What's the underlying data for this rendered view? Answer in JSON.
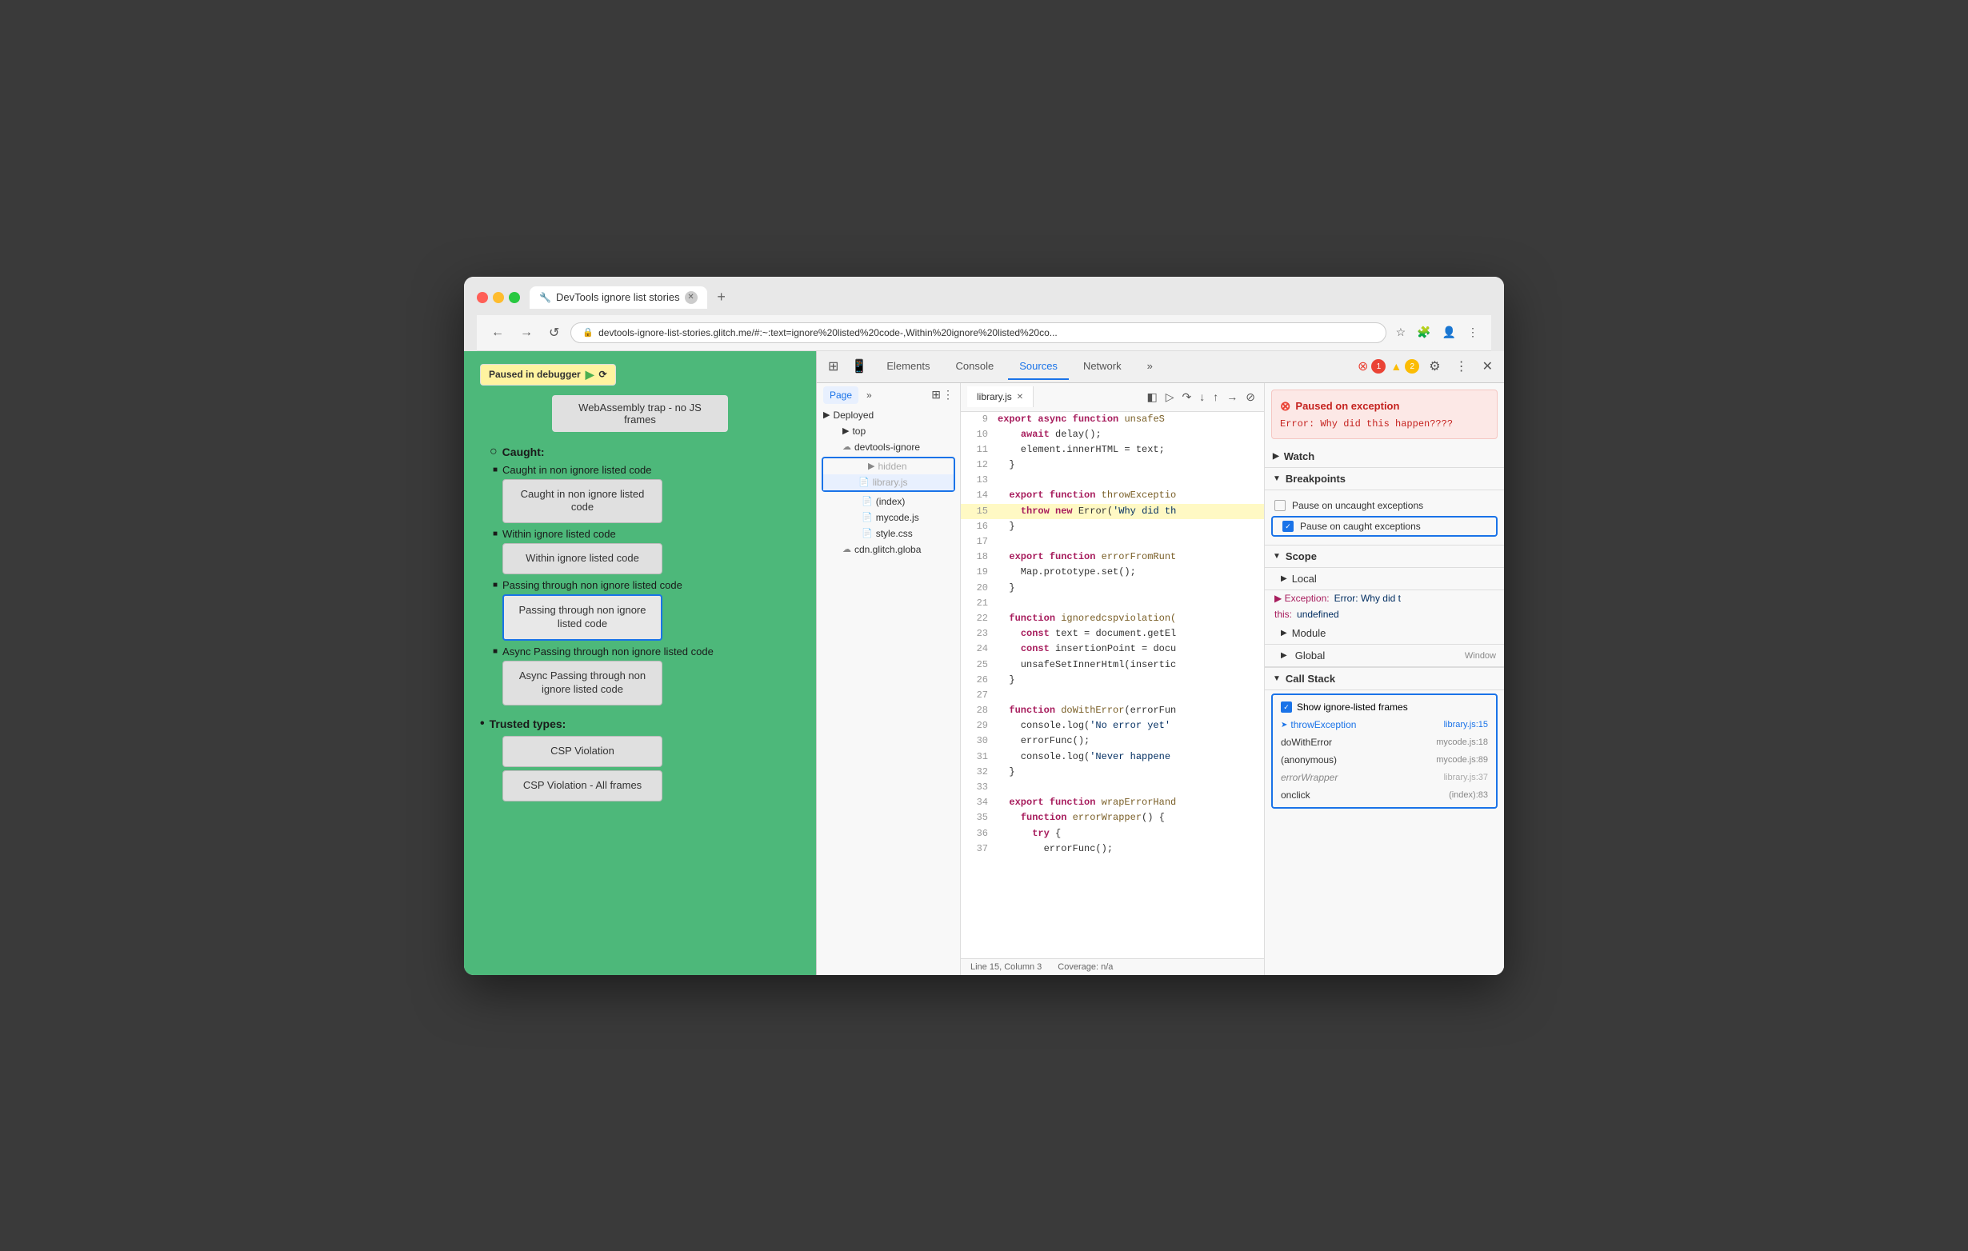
{
  "browser": {
    "tab_title": "DevTools ignore list stories",
    "tab_favicon": "🔧",
    "url": "devtools-ignore-list-stories.glitch.me/#:~:text=ignore%20listed%20code-,Within%20ignore%20listed%20co...",
    "new_tab_label": "+",
    "nav": {
      "back": "←",
      "forward": "→",
      "refresh": "↺",
      "bookmark": "☆",
      "extensions": "🧩",
      "profile": "👤",
      "menu": "⋮"
    }
  },
  "webpage": {
    "paused_label": "Paused in debugger",
    "webassembly_text": "WebAssembly trap - no JS frames",
    "sections": [
      {
        "label": "Caught:",
        "type": "circle",
        "children": [
          {
            "sublabel": "Caught in non ignore listed code",
            "button": "Caught in non ignore listed code"
          },
          {
            "sublabel": "Within ignore listed code",
            "button": "Within ignore listed code"
          },
          {
            "sublabel": "Passing through non ignore listed code",
            "button": "Passing through non ignore listed code",
            "highlighted": true
          },
          {
            "sublabel": "Async Passing through non ignore listed code",
            "button": "Async Passing through non ignore listed code"
          }
        ]
      },
      {
        "label": "Trusted types:",
        "type": "bullet",
        "children": [
          {
            "button": "CSP Violation"
          },
          {
            "button": "CSP Violation - All frames"
          }
        ]
      }
    ]
  },
  "devtools": {
    "tabs": [
      {
        "label": "Elements",
        "active": false
      },
      {
        "label": "Console",
        "active": false
      },
      {
        "label": "Sources",
        "active": true
      },
      {
        "label": "Network",
        "active": false
      },
      {
        "label": "»",
        "active": false
      }
    ],
    "error_count": "1",
    "warn_count": "2",
    "sources_subtabs": [
      {
        "label": "Page",
        "active": true
      },
      {
        "label": "»",
        "active": false
      }
    ],
    "file_tree": {
      "items": [
        {
          "label": "Deployed",
          "depth": 0,
          "icon": "▶",
          "type": "folder"
        },
        {
          "label": "top",
          "depth": 1,
          "icon": "▶",
          "type": "folder"
        },
        {
          "label": "devtools-ignore",
          "depth": 1,
          "icon": "▼",
          "type": "cloud",
          "expanded": true
        },
        {
          "label": "hidden",
          "depth": 2,
          "icon": "▶",
          "type": "folder",
          "in_box": true,
          "dim": true
        },
        {
          "label": "library.js",
          "depth": 3,
          "icon": "📄",
          "type": "file",
          "in_box": true,
          "dim": true,
          "selected": true
        },
        {
          "label": "(index)",
          "depth": 2,
          "icon": "📄",
          "type": "file"
        },
        {
          "label": "mycode.js",
          "depth": 2,
          "icon": "📄",
          "type": "file",
          "colored": "red"
        },
        {
          "label": "style.css",
          "depth": 2,
          "icon": "📄",
          "type": "file",
          "colored": "red"
        },
        {
          "label": "cdn.glitch.globa",
          "depth": 1,
          "icon": "▶",
          "type": "cloud"
        }
      ]
    },
    "editor": {
      "active_file": "library.js",
      "lines": [
        {
          "num": 9,
          "code": "  export async function unsafeS",
          "class": ""
        },
        {
          "num": 10,
          "code": "    await delay();",
          "class": ""
        },
        {
          "num": 11,
          "code": "    element.innerHTML = text;",
          "class": ""
        },
        {
          "num": 12,
          "code": "  }",
          "class": ""
        },
        {
          "num": 13,
          "code": "",
          "class": ""
        },
        {
          "num": 14,
          "code": "  export function throwExceptio",
          "class": ""
        },
        {
          "num": 15,
          "code": "    throw new Error('Why did th",
          "class": "line-highlighted"
        },
        {
          "num": 16,
          "code": "  }",
          "class": ""
        },
        {
          "num": 17,
          "code": "",
          "class": ""
        },
        {
          "num": 18,
          "code": "  export function errorFromRunt",
          "class": ""
        },
        {
          "num": 19,
          "code": "    Map.prototype.set();",
          "class": ""
        },
        {
          "num": 20,
          "code": "  }",
          "class": ""
        },
        {
          "num": 21,
          "code": "",
          "class": ""
        },
        {
          "num": 22,
          "code": "  function ignoredcspviolation(",
          "class": ""
        },
        {
          "num": 23,
          "code": "    const text = document.getEl",
          "class": ""
        },
        {
          "num": 24,
          "code": "    const insertionPoint = docu",
          "class": ""
        },
        {
          "num": 25,
          "code": "    unsafeSetInnerHtml(insertic",
          "class": ""
        },
        {
          "num": 26,
          "code": "  }",
          "class": ""
        },
        {
          "num": 27,
          "code": "",
          "class": ""
        },
        {
          "num": 28,
          "code": "  function doWithError(errorFun",
          "class": ""
        },
        {
          "num": 29,
          "code": "    console.log('No error yet'",
          "class": ""
        },
        {
          "num": 30,
          "code": "    errorFunc();",
          "class": ""
        },
        {
          "num": 31,
          "code": "    console.log('Never happene",
          "class": ""
        },
        {
          "num": 32,
          "code": "  }",
          "class": ""
        },
        {
          "num": 33,
          "code": "",
          "class": ""
        },
        {
          "num": 34,
          "code": "  export function wrapErrorHand",
          "class": ""
        },
        {
          "num": 35,
          "code": "    function errorWrapper() {",
          "class": ""
        },
        {
          "num": 36,
          "code": "      try {",
          "class": ""
        },
        {
          "num": 37,
          "code": "        errorFunc();",
          "class": ""
        }
      ],
      "status_line": "Line 15, Column 3",
      "status_coverage": "Coverage: n/a"
    },
    "debugger": {
      "exception_header": "Paused on exception",
      "exception_detail": "Error: Why did this\nhappen????",
      "sections": {
        "watch": {
          "label": "Watch",
          "expanded": false
        },
        "breakpoints": {
          "label": "Breakpoints",
          "expanded": true,
          "items": [
            {
              "label": "Pause on uncaught exceptions",
              "checked": false
            },
            {
              "label": "Pause on caught exceptions",
              "checked": true,
              "boxed": true
            }
          ]
        },
        "scope": {
          "label": "Scope",
          "expanded": true,
          "subsections": [
            {
              "label": "Local",
              "items": [
                {
                  "key": "▶ Exception:",
                  "val": "Error: Why did t"
                },
                {
                  "key": "this:",
                  "val": "undefined"
                }
              ]
            },
            {
              "label": "Module"
            },
            {
              "label": "Global",
              "right": "Window"
            }
          ]
        },
        "call_stack": {
          "label": "Call Stack",
          "expanded": true,
          "show_ignore_label": "Show ignore-listed frames",
          "show_ignore_checked": true,
          "items": [
            {
              "fn": "throwException",
              "loc": "library.js:15",
              "active": true,
              "dim": false
            },
            {
              "fn": "doWithError",
              "loc": "mycode.js:18",
              "active": false,
              "dim": false
            },
            {
              "fn": "(anonymous)",
              "loc": "mycode.js:89",
              "active": false,
              "dim": false
            },
            {
              "fn": "errorWrapper",
              "loc": "library.js:37",
              "active": false,
              "dim": true
            },
            {
              "fn": "onclick",
              "loc": "(index):83",
              "active": false,
              "dim": false
            }
          ]
        }
      }
    }
  }
}
